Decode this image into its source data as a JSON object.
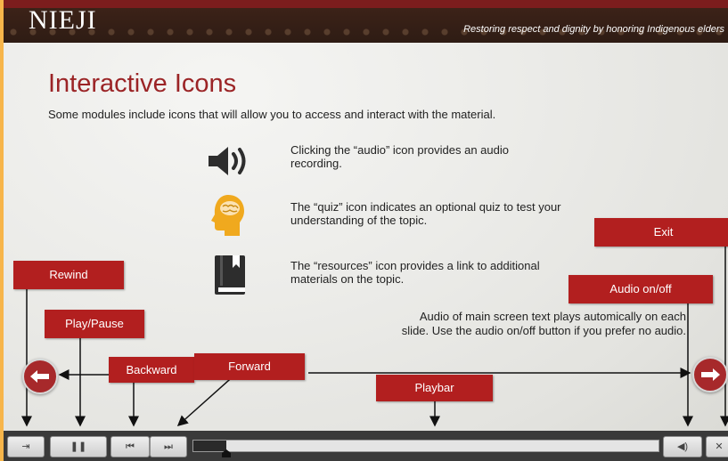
{
  "header": {
    "brand": "NIEJI",
    "tagline": "Restoring respect and dignity by honoring Indigenous elders"
  },
  "main": {
    "title": "Interactive Icons",
    "subtitle": "Some modules include icons that will allow you to access and interact with the material.",
    "icons": [
      {
        "icon": "speaker-icon",
        "text": "Clicking the “audio” icon provides an audio recording."
      },
      {
        "icon": "brain-head-icon",
        "text": "The “quiz” icon indicates an optional quiz to test your understanding of the topic."
      },
      {
        "icon": "book-icon",
        "text": "The “resources” icon provides a link to additional materials on the topic."
      }
    ],
    "audio_note": "Audio of main screen text plays automically on each slide. Use the audio on/off button if you prefer no audio."
  },
  "callouts": {
    "exit": "Exit",
    "rewind": "Rewind",
    "audio_onoff": "Audio on/off",
    "play_pause": "Play/Pause",
    "backward": "Backward",
    "forward": "Forward",
    "playbar": "Playbar"
  },
  "toolbar": {
    "rewind_glyph": "⇥",
    "pause_glyph": "❚❚",
    "prev_glyph": "⏮",
    "next_glyph": "⏭",
    "audio_glyph": "◀)",
    "close_glyph": "✕",
    "progress_fraction": 0.07
  },
  "colors": {
    "accent": "#b21f1f",
    "title": "#9b2426",
    "banner": "#2e1c14",
    "outer": "#f7b54a"
  }
}
